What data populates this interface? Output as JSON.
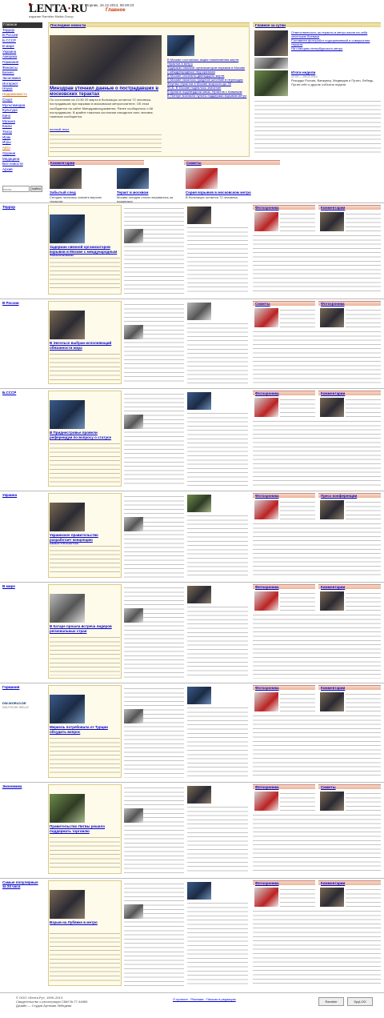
{
  "header": {
    "logo": "LENTA",
    "logo_dot": "·",
    "logo_tld": "RU",
    "tagline": "издание Rambler Media Group",
    "date": "вторник, 16.12.2014, 08:49:23",
    "section_title": "Главное"
  },
  "nav": {
    "items": [
      "Главное",
      "Террор",
      "В России",
      "Б.СССР",
      "В мире",
      "Украина",
      "Америка",
      "Германия",
      "Финансы",
      "Бизнес",
      "Экономика",
      "Интернет",
      "Наука",
      "Недвижимость",
      "Спорт",
      "Мультимедиа",
      "Культура",
      "Кино",
      "Музыка",
      "Книги",
      "Театр",
      "Ирак",
      "Игры",
      "Авто",
      "Оружие",
      "Медицина",
      "Все новости",
      "Архив"
    ]
  },
  "search": {
    "placeholder": "поиск",
    "button": "найти"
  },
  "main": {
    "top_bar": "Последние новости",
    "lead_headline": "Минздрав уточнил данные о пострадавших в московских терактах",
    "lead_text": "По состоянию на 21:50 29 марта в больницах остается 72 человека, пострадавших при взрывах в московском метрополитене. Об этом сообщается на сайте Минздравсоцразвития. Ранее сообщалось о 68 пострадавших. В крайне тяжелом состоянии находятся пять человек, тяжелым сообщается.",
    "lead_more": "полный текст",
    "right_news": [
      "В Москве состоялась акция поминовения жертв терактов в метро",
      "Задержан связной организаторов взрывов в Москве с международным терроризмом",
      "В Москве опознаны двенадцать жертв",
      "В Москве началось траурное шествие в переходах",
      "Жертвы терактов в Москве возросли до 39",
      "ФСБ: В Москве поднялось значение",
      "В Кремле подтвердили связь терактов с Кавказом",
      "В Питере возникли пункты поддержки взрывов метро"
    ],
    "right_bar": "Главное за сутки",
    "right_top": [
      "Ответственность за теракты в метро взяли на себя чеченские боевики",
      "Составлен фоторобот подозреваемой в совершении теракта",
      "На станциях петербургского метро"
    ],
    "olympics_title": "Итоги недели",
    "olympics_date": "22.03 — 28.03.2010",
    "olympics_text": "Рекорды Россия, Ванкувер, Медведев и Путин, Лебедь, Путин-гейт и другие события недели"
  },
  "strip": {
    "left_bar": "Комментарии",
    "right_bar": "Сюжеты",
    "cards": [
      {
        "t": "Забытый след",
        "s": "Сегодня пытались освоить версию терактов"
      },
      {
        "t": "Теракт в москвом",
        "s": "Москве сегодня стоять взорвались за поддержку"
      },
      {
        "t": "Серия взрывов в московском метро",
        "s": "В больницах остается 72 человека"
      }
    ]
  },
  "sections": [
    {
      "name": "Террор",
      "headline": "Задержан связной организаторов взрывов в Москве с международным терроризмом",
      "side": [
        "Фотохроника",
        "Комментарии"
      ]
    },
    {
      "name": "В России",
      "headline": "В Энгельсе выбран исполняющий обязанности мэра",
      "side": [
        "Сюжеты",
        "Фотохроника"
      ]
    },
    {
      "name": "Б.СССР",
      "headline": "В Приднестровье провели референдум по вопросу о статусе",
      "side": [
        "Фотохроника",
        "Комментарии"
      ]
    },
    {
      "name": "Украина",
      "headline": "Украинское правительство разработает концепцию инвестпроектов",
      "side": [
        "Фотохроника",
        "Пресс-конференции"
      ]
    },
    {
      "name": "В мире",
      "headline": "В Катаре прошла встреча лидеров региональных стран",
      "side": [
        "Фотохроника",
        "Комментарии"
      ]
    },
    {
      "name": "Германия",
      "headline": "Меркель потребовала от Турции обсудить вопрос",
      "side": [
        "Фотохроника",
        "Комментарии"
      ]
    },
    {
      "name": "Экономика",
      "headline": "Правительство Литвы решило поддержать торговлю",
      "side": [
        "Фотохроника",
        "Сюжеты"
      ]
    },
    {
      "name": "Самые популярные за 24 часа",
      "headline": "Взрыв на Лубянке в метро",
      "side": [
        "Фотохроника",
        "Комментарии"
      ]
    }
  ],
  "dw": {
    "label": "DW-WORLD.DE",
    "sub": "DEUTSCHE WELLE"
  },
  "footer": {
    "lines": [
      "© ООО «Лента.Ру», 1999–2013",
      "Свидетельство о регистрации СМИ № 77-44865",
      "Дизайн — Студия Артемия Лебедева"
    ],
    "links": "О проекте · Реклама · Письмо в редакцию",
    "counter1": "Rambler",
    "counter2": "SpyLOG"
  }
}
